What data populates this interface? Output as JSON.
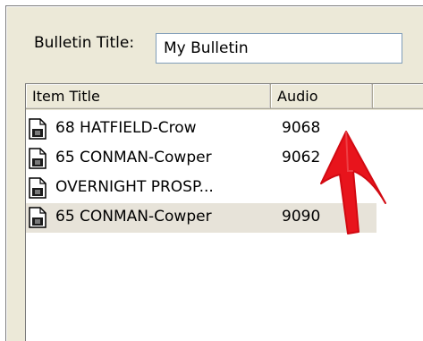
{
  "bulletin": {
    "title_label": "Bulletin Title:",
    "title_value": "My Bulletin"
  },
  "list": {
    "columns": [
      "Item Title",
      "Audio",
      ""
    ],
    "items": [
      {
        "title": "68 HATFIELD-Crow",
        "audio": "9068",
        "selected": false
      },
      {
        "title": "65 CONMAN-Cowper",
        "audio": "9062",
        "selected": false
      },
      {
        "title": "OVERNIGHT PROSP...",
        "audio": "",
        "selected": false
      },
      {
        "title": "65 CONMAN-Cowper",
        "audio": "9090",
        "selected": true
      }
    ],
    "item_icon": "audio-document-icon"
  },
  "annotation": {
    "icon": "red-arrow-icon",
    "color": "#e8141c"
  },
  "colors": {
    "panel": "#ece9d8",
    "selected_row": "#e7e3d9",
    "input_border": "#7f9db9"
  }
}
